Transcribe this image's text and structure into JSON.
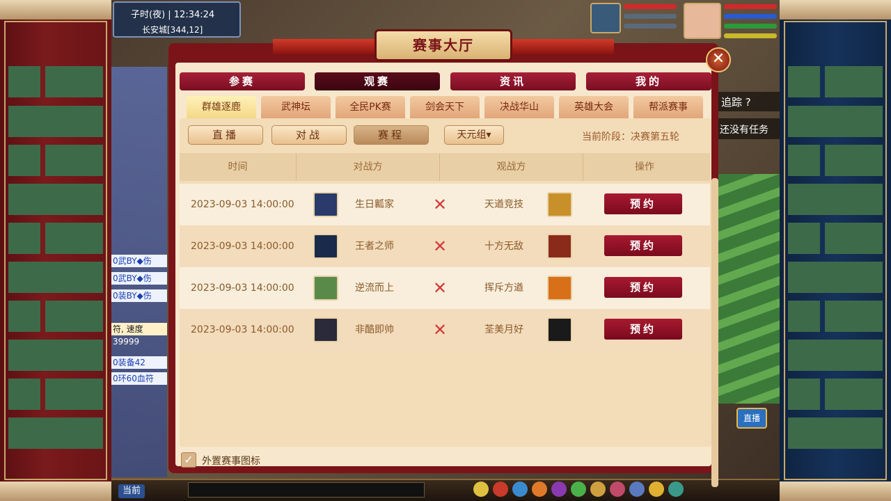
{
  "hud": {
    "time_label": "子时(夜)  | 12:34:24",
    "location": "长安城[344,12]",
    "track_label": "追踪 ?",
    "no_task_label": "还没有任务",
    "live_label": "直播",
    "current_channel": "当前",
    "chat_lines": [
      "0武BY◆伤",
      "0武BY◆伤",
      "0装BY◆伤",
      "符, 速度",
      "39999",
      "0装备42",
      "0环60血符"
    ]
  },
  "dialog": {
    "title": "赛事大厅",
    "close_icon": "close-icon",
    "main_tabs": [
      {
        "label": "参赛",
        "active": false
      },
      {
        "label": "观赛",
        "active": true
      },
      {
        "label": "资讯",
        "active": false
      },
      {
        "label": "我的",
        "active": false
      }
    ],
    "sub_tabs": [
      {
        "label": "群雄逐鹿",
        "active": true
      },
      {
        "label": "武神坛",
        "active": false
      },
      {
        "label": "全民PK赛",
        "active": false
      },
      {
        "label": "剑会天下",
        "active": false
      },
      {
        "label": "决战华山",
        "active": false
      },
      {
        "label": "英雄大会",
        "active": false
      },
      {
        "label": "帮派赛事",
        "active": false
      }
    ],
    "mode_buttons": [
      {
        "label": "直播",
        "active": false
      },
      {
        "label": "对战",
        "active": false
      },
      {
        "label": "赛程",
        "active": true
      }
    ],
    "group_select": "天元组▾",
    "stage_text": "当前阶段：决赛第五轮",
    "table": {
      "headers": [
        "时间",
        "对战方",
        "观战方",
        "操作"
      ],
      "rows": [
        {
          "time": "2023-09-03 14:00:00",
          "team_a": "生日瓤家",
          "team_b": "天遒竞技",
          "action": "预约",
          "a_color": "#2a3a6a",
          "b_color": "#c8902a"
        },
        {
          "time": "2023-09-03 14:00:00",
          "team_a": "王者之师",
          "team_b": "十方无敌",
          "action": "预约",
          "a_color": "#1a2a4a",
          "b_color": "#8a2a1a"
        },
        {
          "time": "2023-09-03 14:00:00",
          "team_a": "逆流而上",
          "team_b": "挥斥方遒",
          "action": "预约",
          "a_color": "#5a8a4a",
          "b_color": "#d8701a"
        },
        {
          "time": "2023-09-03 14:00:00",
          "team_a": "非酷即帅",
          "team_b": "荃美月好",
          "action": "预约",
          "a_color": "#2a2a3a",
          "b_color": "#1a1a1a"
        }
      ]
    },
    "vs_icon": "crossed-swords-icon",
    "footer_checkbox_label": "外置赛事图标",
    "footer_checkbox_checked": true
  },
  "colors": {
    "dialog_border": "#7a1418",
    "button_red": "#a81a30",
    "panel_bg": "#f7e7cc"
  }
}
